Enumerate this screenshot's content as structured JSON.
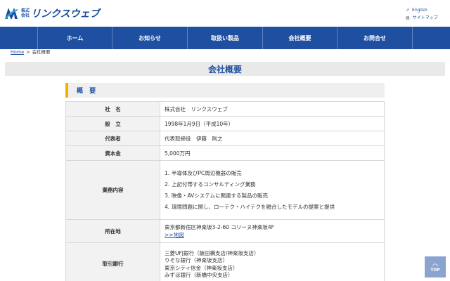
{
  "header": {
    "logo_small_1": "株式",
    "logo_small_2": "会社",
    "logo_name": "リンクスウェブ",
    "links": [
      {
        "label": "English"
      },
      {
        "label": "サイトマップ"
      }
    ]
  },
  "nav": {
    "items": [
      {
        "label": "ホーム"
      },
      {
        "label": "お知らせ"
      },
      {
        "label": "取扱い製品"
      },
      {
        "label": "会社概要"
      },
      {
        "label": "お問合せ"
      }
    ]
  },
  "breadcrumb": {
    "home": "Home",
    "sep": ">",
    "current": "会社概要"
  },
  "page": {
    "title": "会社概要",
    "section_title": "概 要"
  },
  "table": {
    "company_label": "社　名",
    "company_value": "株式会社　リンクスウェブ",
    "founded_label": "設　立",
    "founded_value": "1998年1月9日（平成10年）",
    "rep_label": "代表者",
    "rep_value": "代表取締役　伊藤　則之",
    "capital_label": "資本金",
    "capital_value": "5,000万円",
    "business_label": "業務内容",
    "business_items": [
      {
        "num": "1.",
        "text": "半導体及びPC周辺機器の販売"
      },
      {
        "num": "2.",
        "text": "上記付帯するコンサルティング業務"
      },
      {
        "num": "3.",
        "text": "映像・AVシステムに関連する製品の販売"
      },
      {
        "num": "4.",
        "text": "環境問題に関し、ローテク・ハイテクを融合したモデルの提案と提供"
      }
    ],
    "address_label": "所在地",
    "address_value": "東京都新宿区神楽坂3-2-60 コリーヌ神楽坂4F",
    "map_link": ">>地図",
    "banks_label": "取引銀行",
    "banks": [
      "三菱UFJ銀行（飯田橋支店/神楽坂支店）",
      "りそな銀行（神楽坂支店）",
      "東京シティ信金（神楽坂支店）",
      "みずほ銀行（新橋中央支店）"
    ]
  },
  "top_button": {
    "label": "TOP"
  },
  "colors": {
    "brand": "#1f4fa0",
    "accent": "#f2b300"
  }
}
